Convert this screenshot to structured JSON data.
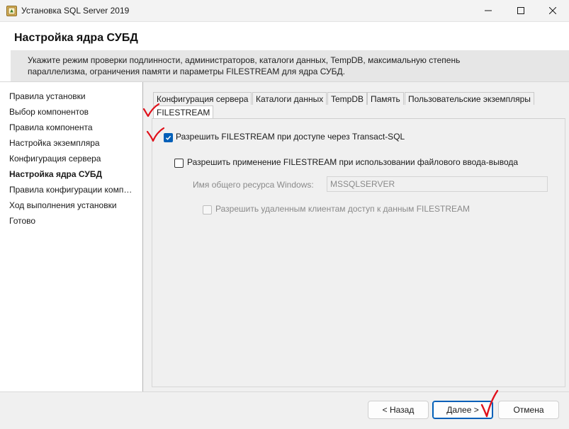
{
  "window": {
    "title": "Установка SQL Server 2019",
    "icon": "sql-server-setup-icon"
  },
  "header": {
    "title": "Настройка ядра СУБД",
    "description_line1": "Укажите режим проверки подлинности, администраторов, каталоги данных, TempDB, максимальную степень",
    "description_line2": "параллелизма, ограничения памяти и параметры FILESTREAM для ядра СУБД."
  },
  "nav": {
    "items": [
      {
        "label": "Правила установки",
        "active": false
      },
      {
        "label": "Выбор компонентов",
        "active": false
      },
      {
        "label": "Правила компонента",
        "active": false
      },
      {
        "label": "Настройка экземпляра",
        "active": false
      },
      {
        "label": "Конфигурация сервера",
        "active": false
      },
      {
        "label": "Настройка ядра СУБД",
        "active": true
      },
      {
        "label": "Правила конфигурации компонента",
        "active": false
      },
      {
        "label": "Ход выполнения установки",
        "active": false
      },
      {
        "label": "Готово",
        "active": false
      }
    ]
  },
  "tabs": [
    {
      "label": "Конфигурация сервера",
      "active": false
    },
    {
      "label": "Каталоги данных",
      "active": false
    },
    {
      "label": "TempDB",
      "active": false
    },
    {
      "label": "Память",
      "active": false
    },
    {
      "label": "Пользовательские экземпляры",
      "active": false
    },
    {
      "label": "FILESTREAM",
      "active": true
    }
  ],
  "filestream": {
    "enable_tsql_label": "Разрешить FILESTREAM при доступе через Transact-SQL",
    "enable_tsql_checked": true,
    "enable_file_io_label": "Разрешить применение FILESTREAM при использовании файлового ввода-вывода",
    "enable_file_io_checked": false,
    "share_name_label": "Имя общего ресурса Windows:",
    "share_name_value": "MSSQLSERVER",
    "allow_remote_label": "Разрешить удаленным клиентам доступ к данным FILESTREAM",
    "allow_remote_checked": false,
    "allow_remote_enabled": false
  },
  "footer": {
    "back_label": "< Назад",
    "next_label": "Далее >",
    "cancel_label": "Отмена"
  },
  "colors": {
    "accent": "#005fb8",
    "annotation": "#e0101a"
  }
}
